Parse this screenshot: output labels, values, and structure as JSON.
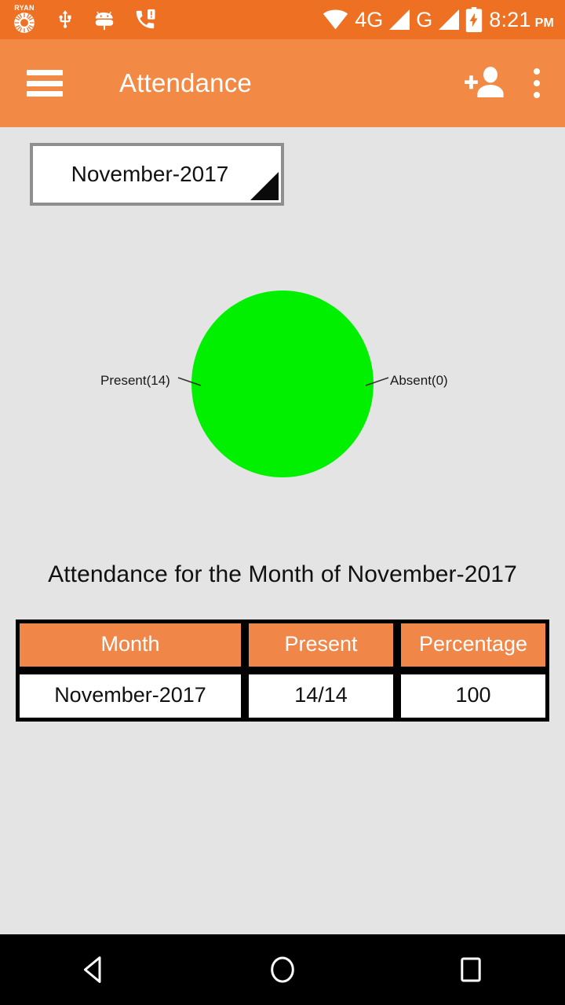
{
  "status_bar": {
    "time": "8:21",
    "ampm": "PM",
    "network_primary": "4G",
    "network_secondary": "G",
    "brand_logo_text": "RYAN",
    "icons": [
      "ryan-logo-icon",
      "usb-icon",
      "android-debug-icon",
      "missed-call-icon",
      "wifi-icon",
      "signal-4g-icon",
      "signal-g-icon",
      "battery-charging-icon"
    ],
    "background_color": "#ee7023"
  },
  "app_bar": {
    "title": "Attendance",
    "menu_icon": "hamburger-icon",
    "add_user_icon": "add-person-icon",
    "overflow_icon": "more-vert-icon",
    "background_color": "#f28a46"
  },
  "spinner": {
    "selected": "November-2017",
    "arrow_icon": "dropdown-triangle-icon"
  },
  "chart_data": {
    "type": "pie",
    "title": "",
    "labels": [
      "Present(14)",
      "Absent(0)"
    ],
    "categories": [
      "Present",
      "Absent"
    ],
    "values": [
      14,
      0
    ],
    "percentages": [
      100,
      0
    ],
    "colors": [
      "#00f000",
      "#ff0000"
    ],
    "legend_position": "callout-labels",
    "left_label": "Present(14)",
    "right_label": "Absent(0)"
  },
  "heading": "Attendance for the Month of November-2017",
  "table": {
    "headers": [
      "Month",
      "Present",
      "Percentage"
    ],
    "rows": [
      [
        "November-2017",
        "14/14",
        "100"
      ]
    ],
    "header_bg": "#f08648",
    "header_color": "#ffffff"
  },
  "nav_bar": {
    "back_label": "back-button",
    "home_label": "home-button",
    "recents_label": "recents-button"
  }
}
